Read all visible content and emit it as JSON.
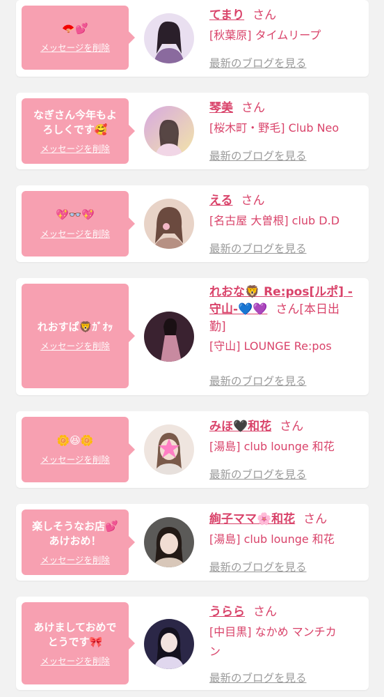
{
  "cards": [
    {
      "message_lines": [
        "🪭💕"
      ],
      "delete_label": "メッセージを削除",
      "name": "てまり",
      "name_suffix": "さん",
      "shop_lines": [
        "[秋葉原] タイムリープ"
      ],
      "blog_label": "最新のブログを見る",
      "avatar_colors": [
        "#e9dff0",
        "#8a6a9e"
      ]
    },
    {
      "message_lines": [
        "なぎさん今年もよ",
        "ろしくです🥰"
      ],
      "delete_label": "メッセージを削除",
      "name": "琴美",
      "name_suffix": "さん",
      "shop_lines": [
        "[桜木町・野毛] Club Neo"
      ],
      "blog_label": "最新のブログを見る",
      "avatar_colors": [
        "#e7b7d8",
        "#f2e4a8"
      ]
    },
    {
      "message_lines": [
        "💖👓💖"
      ],
      "delete_label": "メッセージを削除",
      "name": "える",
      "name_suffix": "さん",
      "shop_lines": [
        "[名古屋 大曽根] club D.D"
      ],
      "blog_label": "最新のブログを見る",
      "avatar_colors": [
        "#e8d3c7",
        "#b69083"
      ]
    },
    {
      "message_lines": [
        "れおすぱ🦁ｶﾞｵｯ"
      ],
      "delete_label": "メッセージを削除",
      "name_lines": [
        "れおな🦁 Re:pos[ルポ] -",
        "守山-💙💜"
      ],
      "name_suffix": "さん[本日出",
      "name_suffix_line2": "勤]",
      "shop_lines": [
        "[守山] LOUNGE Re:pos"
      ],
      "blog_label": "最新のブログを見る",
      "avatar_colors": [
        "#3a2230",
        "#c88aa0"
      ]
    },
    {
      "message_lines": [
        "🌼😆🌼"
      ],
      "delete_label": "メッセージを削除",
      "name": "みほ🖤和花",
      "name_suffix": "さん",
      "shop_lines": [
        "[湯島] club lounge 和花"
      ],
      "blog_label": "最新のブログを見る",
      "avatar_colors": [
        "#efe5df",
        "#ff7fc4"
      ]
    },
    {
      "message_lines": [
        "楽しそうなお店💕",
        "あけおめ！"
      ],
      "delete_label": "メッセージを削除",
      "name": "絢子ママ🌸和花",
      "name_suffix": "さん",
      "shop_lines": [
        "[湯島] club lounge 和花"
      ],
      "blog_label": "最新のブログを見る",
      "avatar_colors": [
        "#5b5a58",
        "#d8c7b9"
      ]
    },
    {
      "message_lines": [
        "あけましておめで",
        "とうです🎀"
      ],
      "delete_label": "メッセージを削除",
      "name": "うらら",
      "name_suffix": "さん",
      "shop_lines": [
        "[中目黒] なかめ マンチカ",
        "ン"
      ],
      "blog_label": "最新のブログを見る",
      "avatar_colors": [
        "#2b2747",
        "#e0d7ee"
      ]
    }
  ]
}
